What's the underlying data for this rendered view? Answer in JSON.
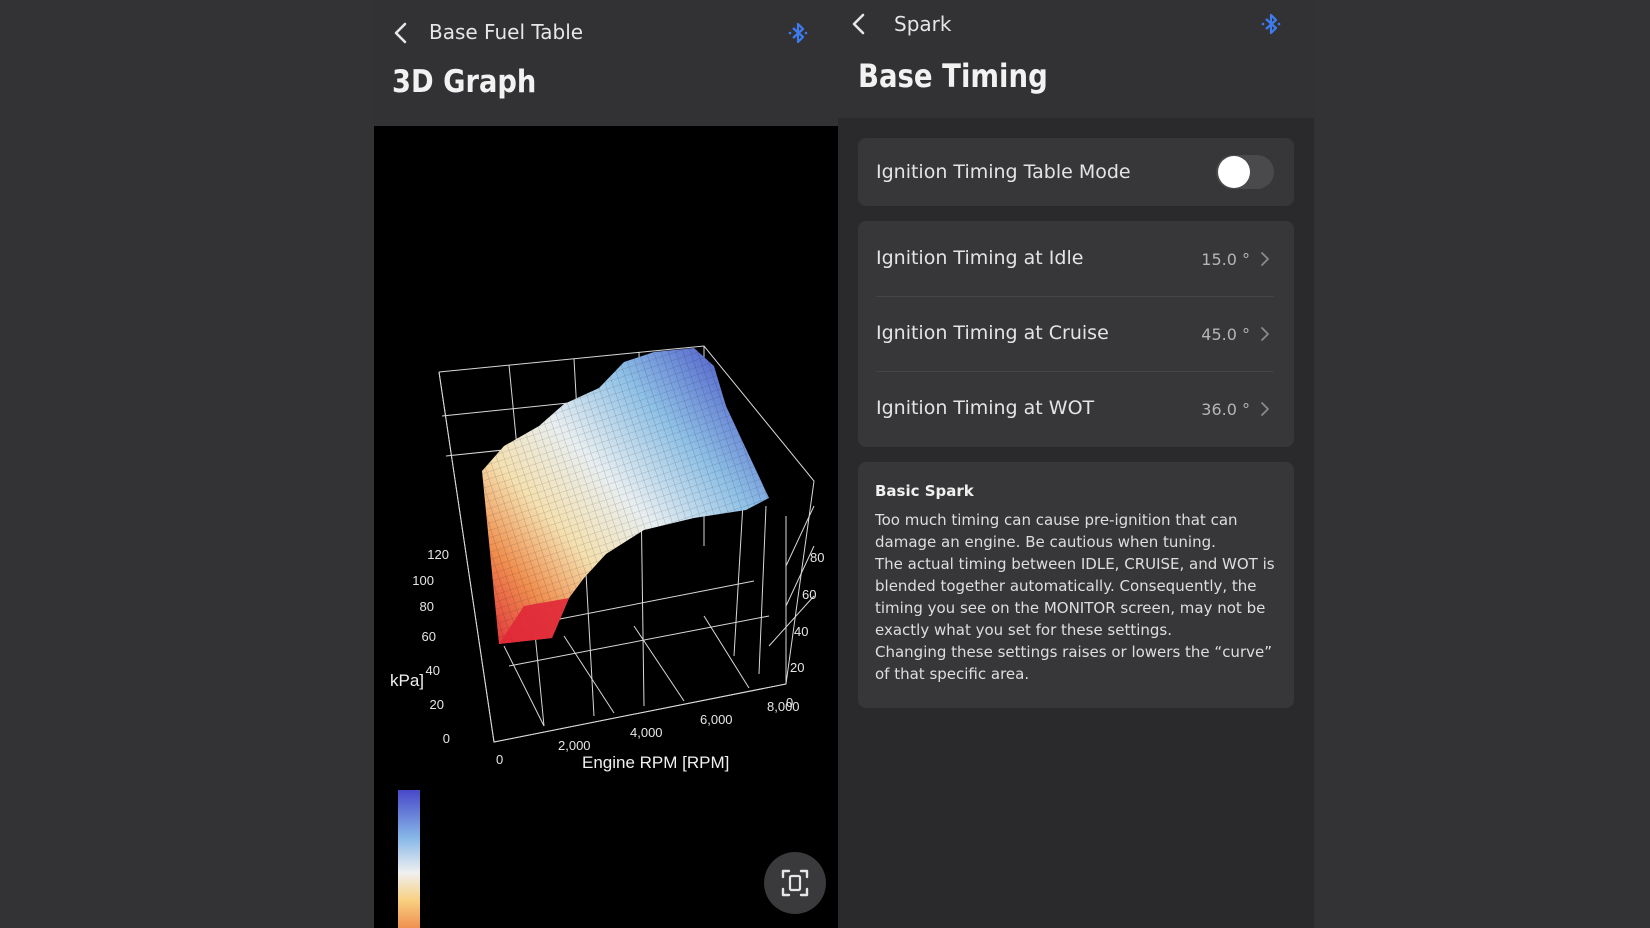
{
  "left": {
    "title": "Base Fuel Table",
    "heading": "3D Graph",
    "graph": {
      "x_axis_label": "Engine RPM [RPM]",
      "x_ticks": [
        "0",
        "2,000",
        "4,000",
        "6,000",
        "8,000"
      ],
      "y_axis_label": "kPa]",
      "y_ticks": [
        "0",
        "20",
        "40",
        "60",
        "80",
        "100",
        "120"
      ],
      "right_ticks": [
        "0",
        "20",
        "40",
        "60",
        "80"
      ],
      "colorscale": [
        "#4848c8",
        "#88b8e8",
        "#f0f0f0",
        "#f8d080",
        "#f09050",
        "#e83040"
      ]
    }
  },
  "right": {
    "title": "Spark",
    "heading": "Base Timing",
    "toggle_label": "Ignition Timing Table Mode",
    "toggle_on": false,
    "rows": [
      {
        "label": "Ignition Timing at Idle",
        "value": "15.0 °"
      },
      {
        "label": "Ignition Timing at Cruise",
        "value": "45.0 °"
      },
      {
        "label": "Ignition Timing at WOT",
        "value": "36.0 °"
      }
    ],
    "info": {
      "title": "Basic Spark",
      "paragraphs": [
        "Too much timing can cause pre-ignition that can damage an engine. Be cautious when tuning.",
        "The actual timing between IDLE, CRUISE, and WOT is blended together automatically. Consequently, the timing you see on the MONITOR screen, may not be exactly what you set for these settings.",
        "Changing these settings raises or lowers the “curve” of that specific area."
      ]
    }
  },
  "colors": {
    "bluetooth": "#3d7cf0",
    "background": "#333336",
    "panel": "#2a2a2c",
    "card": "#373739"
  },
  "icons": [
    "back-chevron-icon",
    "bluetooth-icon",
    "fullscreen-icon",
    "chevron-right-icon"
  ]
}
